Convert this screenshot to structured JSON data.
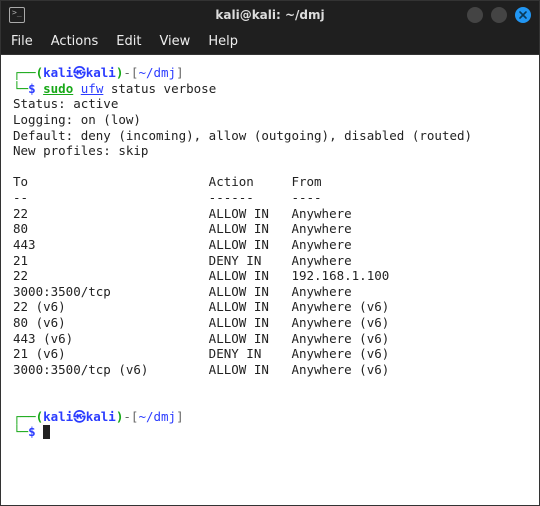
{
  "titlebar": {
    "icon_glyph": ">_",
    "title": "kali@kali: ~/dmj"
  },
  "menubar": {
    "file": "File",
    "actions": "Actions",
    "edit": "Edit",
    "view": "View",
    "help": "Help"
  },
  "prompt": {
    "open": "┌──(",
    "user": "kali",
    "skull": "㉿",
    "host": "kali",
    "close_paren": ")",
    "dash_open": "-[",
    "path": "~/dmj",
    "close_bracket": "]",
    "line2_open": "└─",
    "dollar": "$ "
  },
  "command": {
    "sudo": "sudo",
    "sp1": " ",
    "ufw": "ufw",
    "rest": " status verbose"
  },
  "output": {
    "status": "Status: active",
    "logging": "Logging: on (low)",
    "defaults": "Default: deny (incoming), allow (outgoing), disabled (routed)",
    "newprofiles": "New profiles: skip",
    "blank": "",
    "header": {
      "to": "To",
      "action": "Action",
      "from": "From"
    },
    "rules": [
      {
        "to": "22",
        "action": "ALLOW IN",
        "from": "Anywhere"
      },
      {
        "to": "80",
        "action": "ALLOW IN",
        "from": "Anywhere"
      },
      {
        "to": "443",
        "action": "ALLOW IN",
        "from": "Anywhere"
      },
      {
        "to": "21",
        "action": "DENY IN",
        "from": "Anywhere"
      },
      {
        "to": "22",
        "action": "ALLOW IN",
        "from": "192.168.1.100"
      },
      {
        "to": "3000:3500/tcp",
        "action": "ALLOW IN",
        "from": "Anywhere"
      },
      {
        "to": "22 (v6)",
        "action": "ALLOW IN",
        "from": "Anywhere (v6)"
      },
      {
        "to": "80 (v6)",
        "action": "ALLOW IN",
        "from": "Anywhere (v6)"
      },
      {
        "to": "443 (v6)",
        "action": "ALLOW IN",
        "from": "Anywhere (v6)"
      },
      {
        "to": "21 (v6)",
        "action": "DENY IN",
        "from": "Anywhere (v6)"
      },
      {
        "to": "3000:3500/tcp (v6)",
        "action": "ALLOW IN",
        "from": "Anywhere (v6)"
      }
    ],
    "dashes": "--"
  },
  "cols": {
    "to": 26,
    "action": 11
  }
}
